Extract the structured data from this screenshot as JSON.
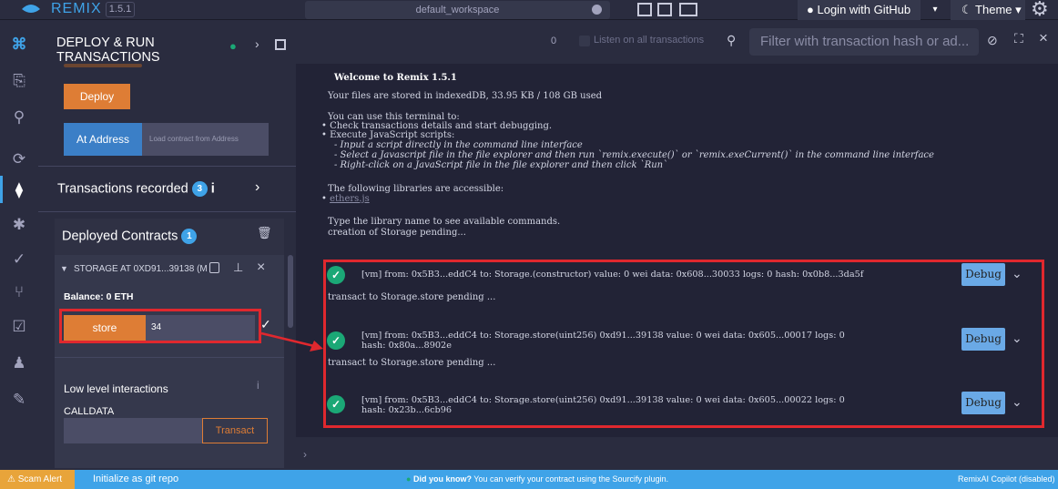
{
  "topbar": {
    "app_name": "REMIX",
    "version": "1.5.1",
    "workspace": "default_workspace",
    "login": "Login with GitHub",
    "theme": "Theme"
  },
  "panel": {
    "title": "DEPLOY & RUN TRANSACTIONS",
    "deploy_label": "Deploy",
    "at_address_label": "At Address",
    "at_address_placeholder": "Load contract from Address",
    "transactions_recorded": "Transactions recorded",
    "transactions_count": "3",
    "deployed_contracts": "Deployed Contracts",
    "deployed_count": "1",
    "contract_name": "STORAGE AT 0XD91...39138 (M",
    "balance": "Balance: 0 ETH",
    "store_label": "store",
    "store_value": "34",
    "low_level": "Low level interactions",
    "calldata": "CALLDATA",
    "transact_label": "Transact"
  },
  "terminal": {
    "tx_count": "0",
    "listen_label": "Listen on all transactions",
    "filter_placeholder": "Filter with transaction hash or ad...",
    "welcome": "Welcome to Remix 1.5.1",
    "stored": "Your files are stored in indexedDB, 33.95 KB / 108 GB used",
    "can_use": "You can use this terminal to:",
    "bullet1": "Check transactions details and start debugging.",
    "bullet2": "Execute JavaScript scripts:",
    "sub1": "- Input a script directly in the command line interface",
    "sub2": "- Select a Javascript file in the file explorer and then run `remix.execute()` or `remix.exeCurrent()`  in the command line interface",
    "sub3": "- Right-click on a JavaScript file in the file explorer and then click `Run`",
    "libs": "The following libraries are accessible:",
    "lib1": "ethers.js",
    "type_lib": "Type the library name to see available commands.",
    "creation": "creation of Storage pending...",
    "pending": "transact to Storage.store pending ...",
    "transactions": [
      {
        "line1": "[vm]  from: 0x5B3...eddC4 to: Storage.(constructor) value: 0 wei data: 0x608...30033 logs: 0 hash: 0x0b8...3da5f",
        "line2": ""
      },
      {
        "line1": "[vm]  from: 0x5B3...eddC4 to: Storage.store(uint256) 0xd91...39138 value: 0 wei data: 0x605...00017 logs: 0",
        "line2": "hash: 0x80a...8902e"
      },
      {
        "line1": "[vm]  from: 0x5B3...eddC4 to: Storage.store(uint256) 0xd91...39138 value: 0 wei data: 0x605...00022 logs: 0",
        "line2": "hash: 0x23b...6cb96"
      }
    ],
    "debug_label": "Debug"
  },
  "status": {
    "scam": "Scam Alert",
    "git": "Initialize as git repo",
    "did_you_know": "Did you know?",
    "tip": "You can verify your contract using the Sourcify plugin.",
    "copilot": "RemixAI Copilot (disabled)"
  },
  "colors": {
    "accent": "#3fa3e8",
    "deploy": "#de7d35",
    "highlight": "#e0282e",
    "success": "#1ba876"
  }
}
